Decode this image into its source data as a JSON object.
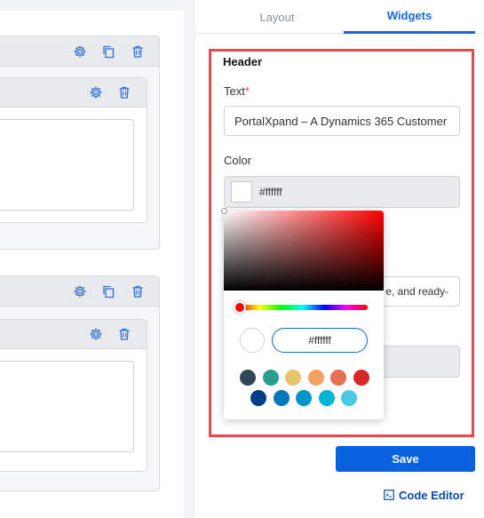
{
  "tabs": {
    "layout_label": "Layout",
    "widgets_label": "Widgets"
  },
  "header_section": {
    "title": "Header",
    "text_label": "Text",
    "required_mark": "*",
    "text_value": "PortalXpand – A Dynamics 365 Customer",
    "color_label": "Color",
    "color_value": "#ffffff"
  },
  "obscured_fields": {
    "partial_text_value": "e, and ready-"
  },
  "color_picker": {
    "hex_value": "#ffffff",
    "hue_color": "#ff0000",
    "swatches_row1": [
      "#2e4756",
      "#2a9d8f",
      "#e9c46a",
      "#f4a261",
      "#e76f51",
      "#d62828"
    ],
    "swatches_row2": [
      "#023e8a",
      "#0077b6",
      "#0096c7",
      "#00b4d8",
      "#48cae4"
    ]
  },
  "actions": {
    "save_label": "Save",
    "code_editor_label": "Code Editor"
  },
  "colors": {
    "accent": "#1769d6",
    "save_button": "#0a62e0",
    "highlight_border": "#e5484d",
    "icon_blue": "#2f6fd6"
  }
}
